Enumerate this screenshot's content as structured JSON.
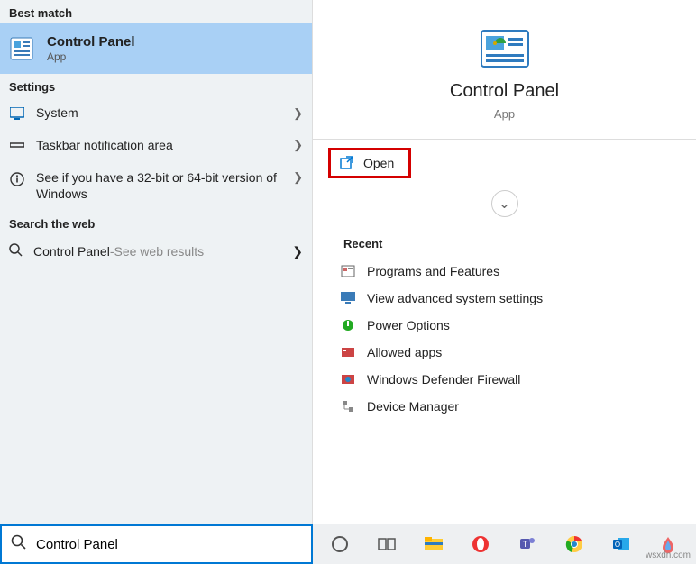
{
  "left": {
    "best_match_label": "Best match",
    "best_match": {
      "title": "Control Panel",
      "subtitle": "App"
    },
    "settings_label": "Settings",
    "settings": [
      {
        "label": "System"
      },
      {
        "label": "Taskbar notification area"
      },
      {
        "label": "See if you have a 32-bit or 64-bit version of Windows"
      }
    ],
    "search_web_label": "Search the web",
    "web": {
      "prefix": "Control Panel",
      "dash": " - ",
      "suffix": "See web results"
    }
  },
  "right": {
    "title": "Control Panel",
    "subtitle": "App",
    "open_label": "Open",
    "recent_label": "Recent",
    "recent": [
      "Programs and Features",
      "View advanced system settings",
      "Power Options",
      "Allowed apps",
      "Windows Defender Firewall",
      "Device Manager"
    ]
  },
  "search": {
    "value": "Control Panel"
  },
  "watermark": "wsxdn.com"
}
